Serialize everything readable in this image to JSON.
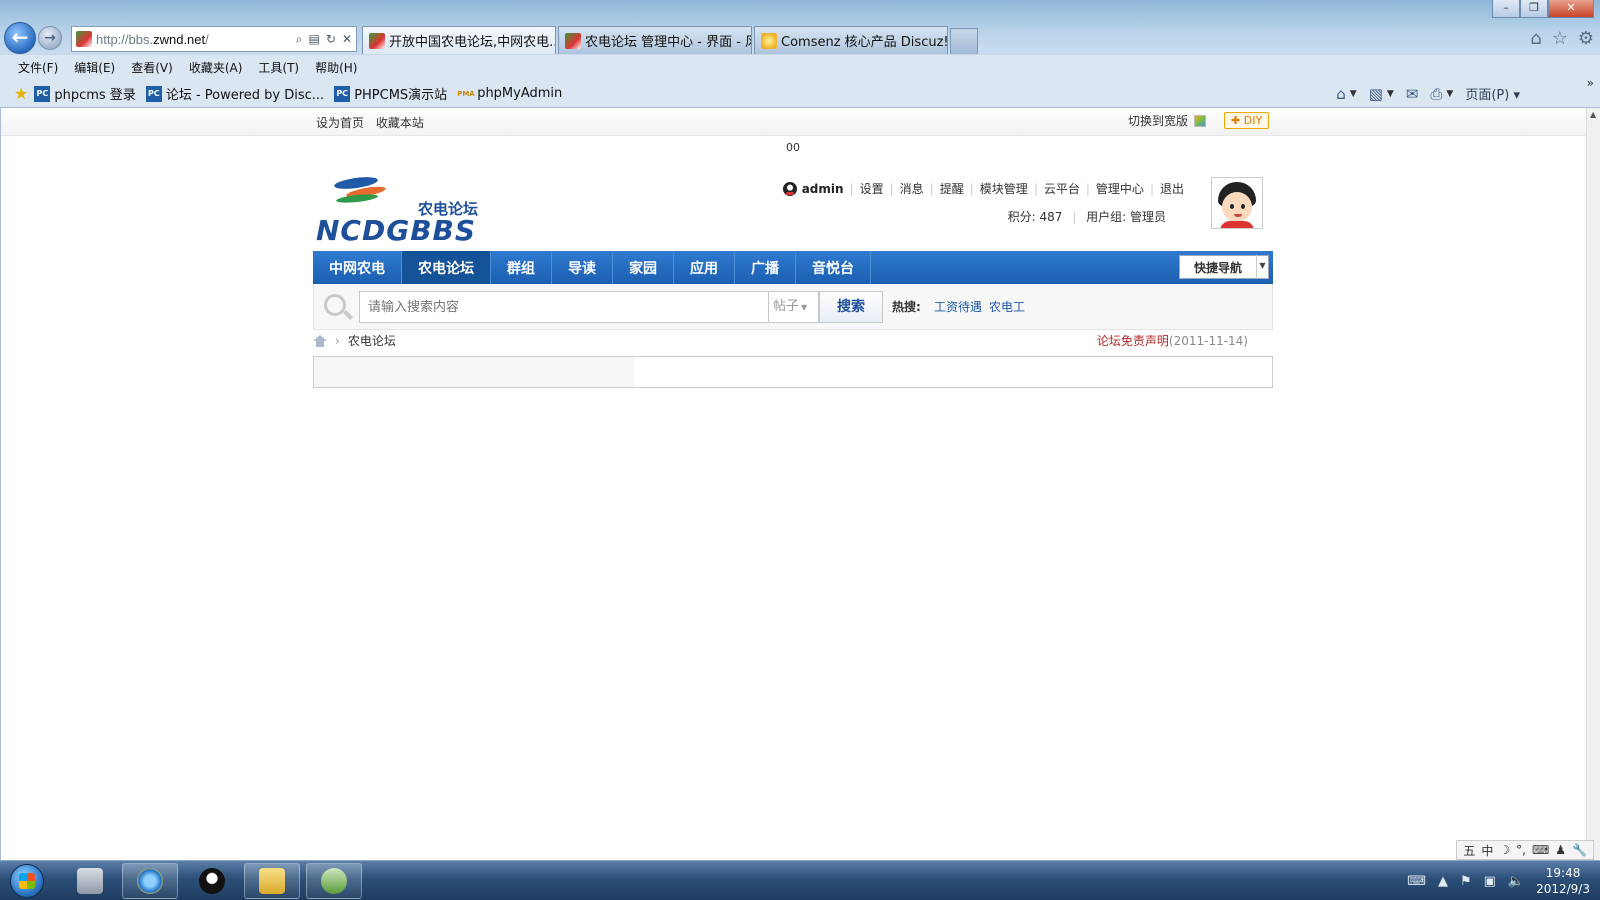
{
  "browser": {
    "address": {
      "url_prefix": "http://bbs.",
      "url_domain": "zwnd.net",
      "url_suffix": "/"
    },
    "tabs": [
      {
        "label": "开放中国农电论坛,中网农电...",
        "active": true
      },
      {
        "label": "农电论坛 管理中心 - 界面 - 风...",
        "active": false
      },
      {
        "label": "Comsenz 核心产品 Discuz! X...",
        "active": false
      }
    ],
    "menu": [
      "文件(F)",
      "编辑(E)",
      "查看(V)",
      "收藏夹(A)",
      "工具(T)",
      "帮助(H)"
    ],
    "favorites": [
      {
        "label": "phpcms 登录",
        "icon": "PC"
      },
      {
        "label": "论坛 - Powered by Disc...",
        "icon": "PC"
      },
      {
        "label": "PHPCMS演示站",
        "icon": "PC"
      },
      {
        "label": "phpMyAdmin",
        "icon": "PMA"
      }
    ],
    "page_menu_label": "页面(P)"
  },
  "forum": {
    "topbar": {
      "set_home": "设为首页",
      "bookmark": "收藏本站",
      "switch_width": "切换到宽版",
      "diy": "DIY"
    },
    "ad_text": "00",
    "logo": {
      "cn": "农电论坛",
      "en": "NCDGBBS"
    },
    "user": {
      "name": "admin",
      "links": [
        "设置",
        "消息",
        "提醒",
        "模块管理",
        "云平台",
        "管理中心",
        "退出"
      ],
      "points_label": "积分: 487",
      "group_label": "用户组: 管理员"
    },
    "nav": [
      "中网农电",
      "农电论坛",
      "群组",
      "导读",
      "家园",
      "应用",
      "广播",
      "音悦台"
    ],
    "nav_active_index": 1,
    "quick_nav": "快捷导航",
    "search": {
      "placeholder": "请输入搜索内容",
      "type": "帖子",
      "button": "搜索",
      "hot_label": "热搜:",
      "hot_words": [
        "工资待遇",
        "农电工"
      ]
    },
    "breadcrumb": {
      "current": "农电论坛"
    },
    "disclaimer": {
      "link": "论坛免责声明",
      "date": "(2011-11-14)"
    }
  },
  "taskbar": {
    "clock_time": "19:48",
    "clock_date": "2012/9/3"
  },
  "ime": [
    "五",
    "中",
    "☽",
    "°,",
    "⌨",
    "♟",
    "🔧"
  ],
  "colors": {
    "nav_blue": "#1b5fb0",
    "nav_active": "#155399",
    "link_blue": "#1e5aa8",
    "disclaimer_red": "#b02a2a",
    "diy_orange": "#e27b00"
  }
}
